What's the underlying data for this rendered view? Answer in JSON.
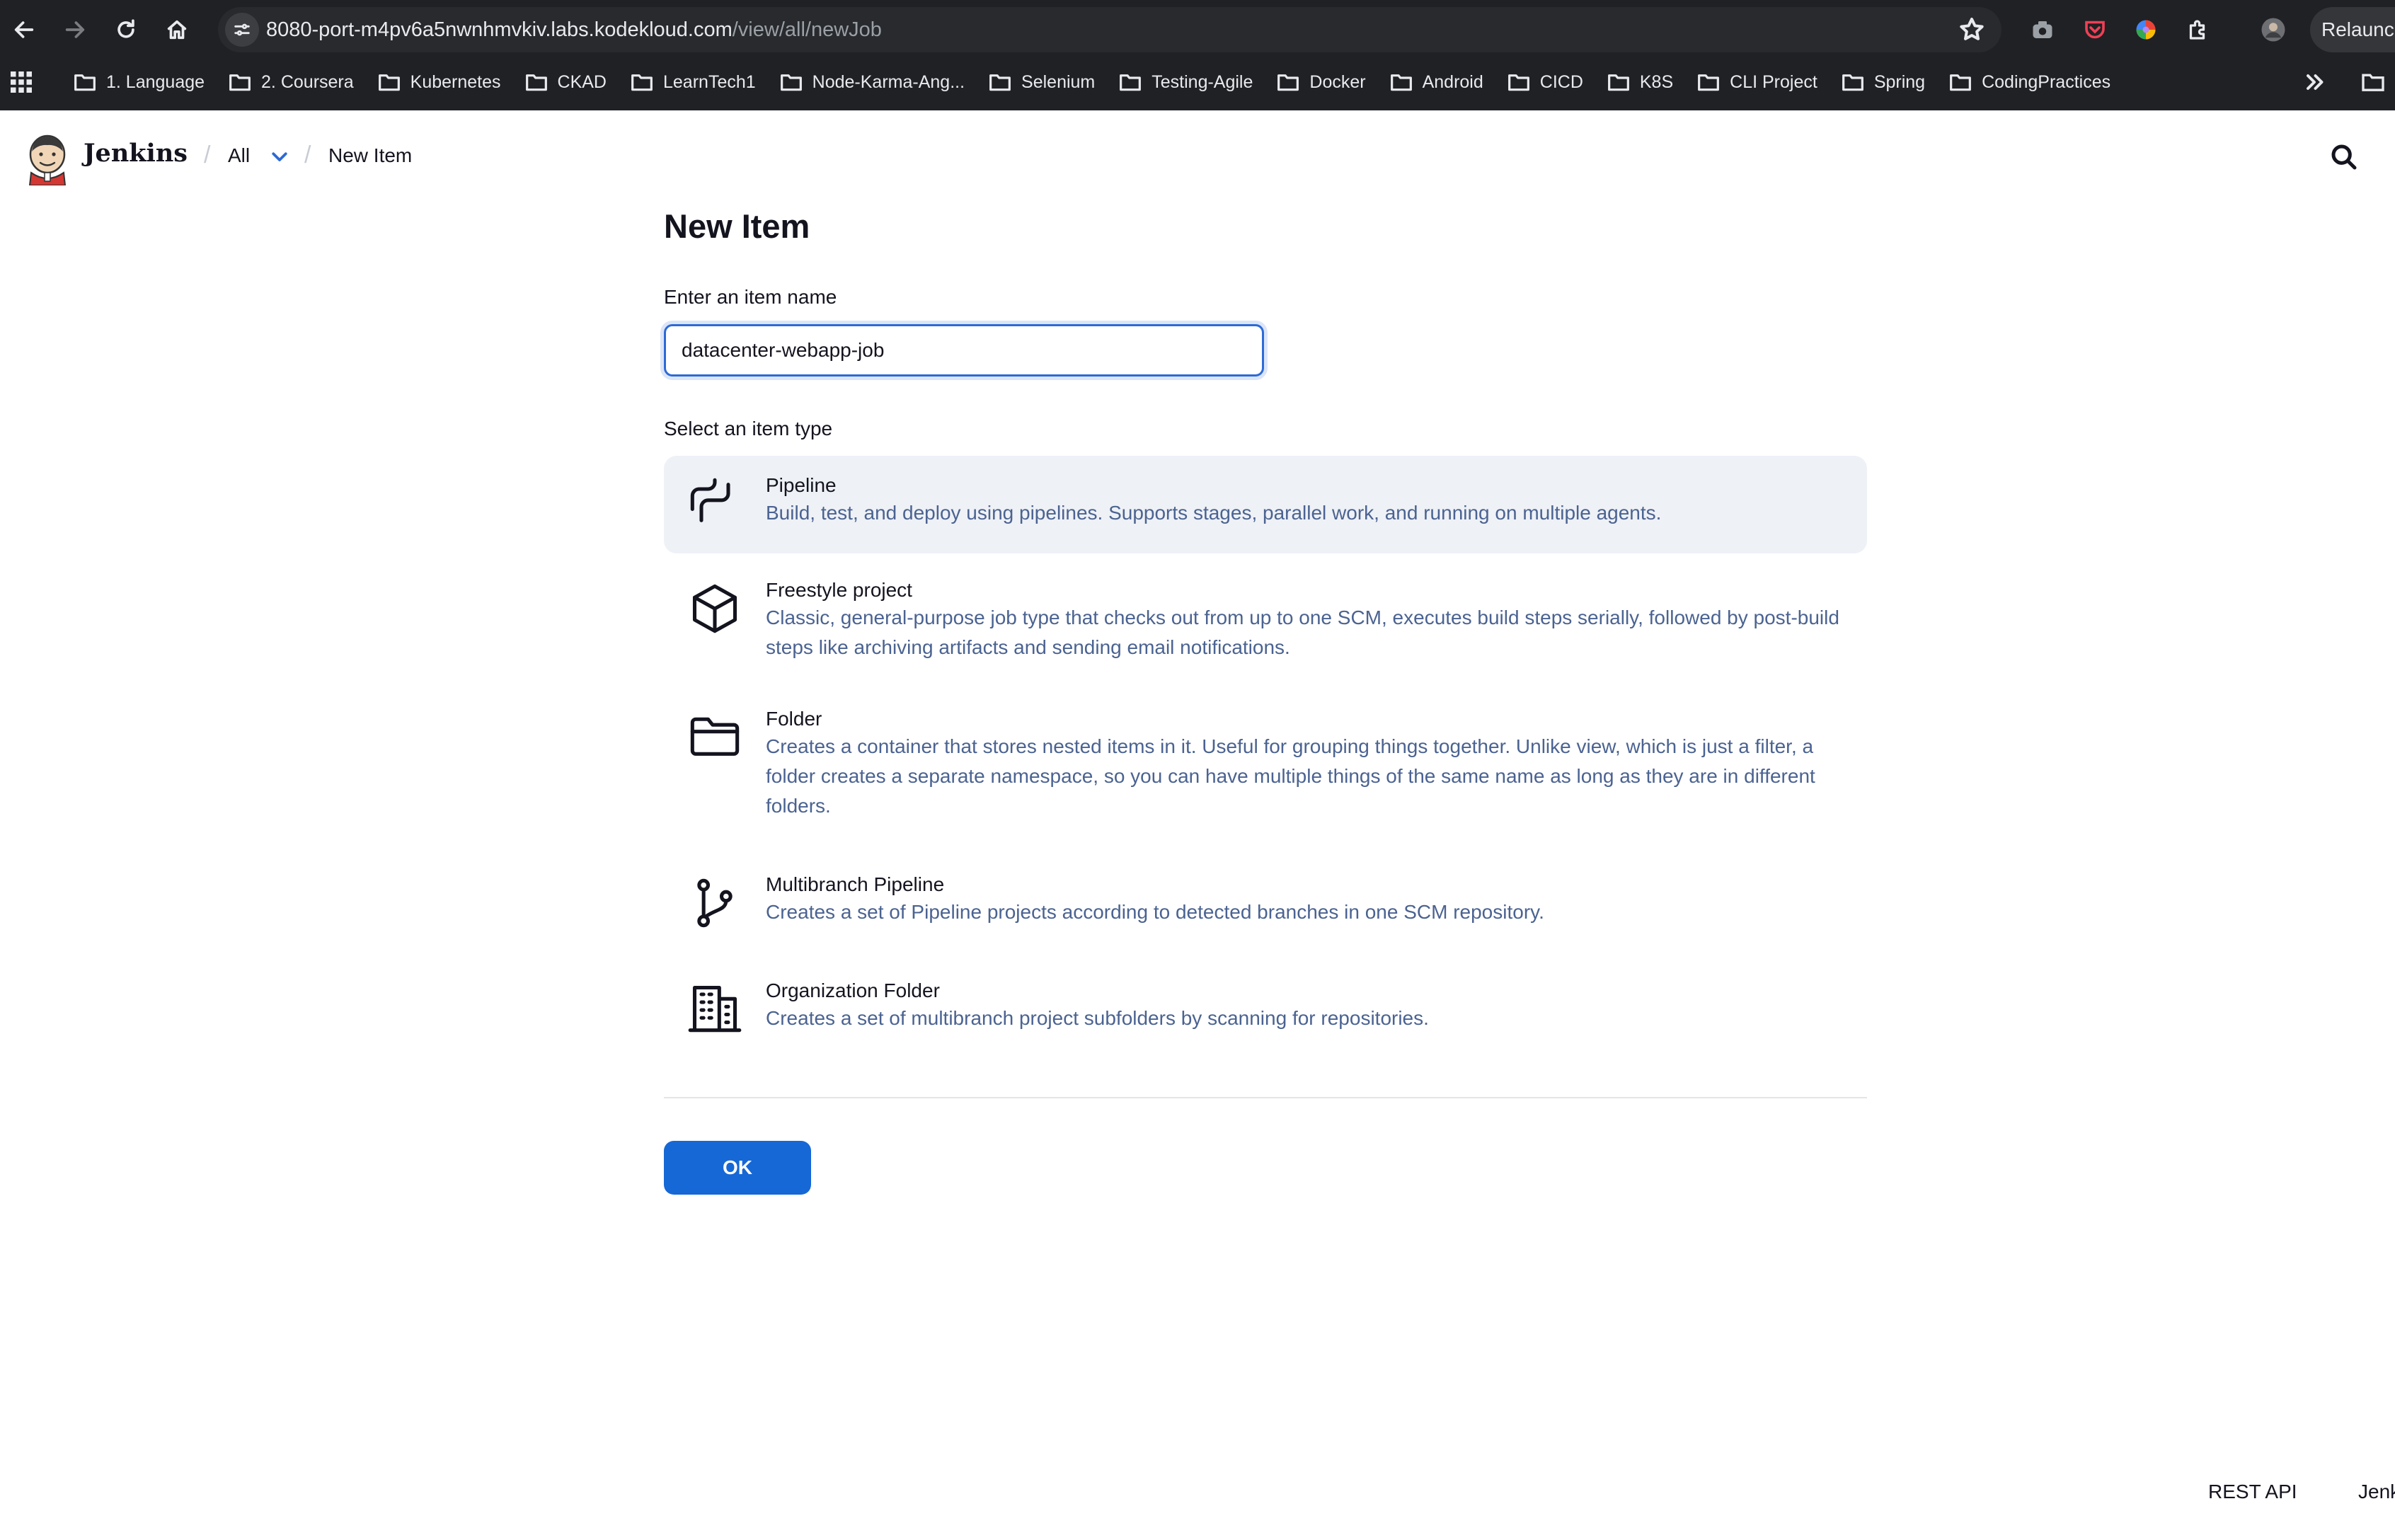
{
  "browser": {
    "url_host": "8080-port-m4pv6a5nwnhmvkiv.labs.kodekloud.com",
    "url_path": "/view/all/newJob",
    "relaunch_label": "Relaunch"
  },
  "bookmarks": [
    "1. Language",
    "2. Coursera",
    "Kubernetes",
    "CKAD",
    "LearnTech1",
    "Node-Karma-Ang...",
    "Selenium",
    "Testing-Agile",
    "Docker",
    "Android",
    "CICD",
    "K8S",
    "CLI Project",
    "Spring",
    "CodingPractices"
  ],
  "header": {
    "brand": "Jenkins",
    "crumb_all": "All",
    "crumb_current": "New Item"
  },
  "form": {
    "title": "New Item",
    "name_label": "Enter an item name",
    "name_value": "datacenter-webapp-job",
    "type_label": "Select an item type",
    "ok_label": "OK"
  },
  "item_types": [
    {
      "title": "Pipeline",
      "desc": "Build, test, and deploy using pipelines. Supports stages, parallel work, and running on multiple agents.",
      "icon": "pipeline-icon",
      "selected": true
    },
    {
      "title": "Freestyle project",
      "desc": "Classic, general-purpose job type that checks out from up to one SCM, executes build steps serially, followed by post-build steps like archiving artifacts and sending email notifications.",
      "icon": "cube-icon",
      "selected": false
    },
    {
      "title": "Folder",
      "desc": "Creates a container that stores nested items in it. Useful for grouping things together. Unlike view, which is just a filter, a folder creates a separate namespace, so you can have multiple things of the same name as long as they are in different folders.",
      "icon": "folder-icon",
      "selected": false
    },
    {
      "title": "Multibranch Pipeline",
      "desc": "Creates a set of Pipeline projects according to detected branches in one SCM repository.",
      "icon": "branch-icon",
      "selected": false
    },
    {
      "title": "Organization Folder",
      "desc": "Creates a set of multibranch project subfolders by scanning for repositories.",
      "icon": "building-icon",
      "selected": false
    }
  ],
  "footer": {
    "rest_api": "REST API",
    "version": "Jenk"
  }
}
